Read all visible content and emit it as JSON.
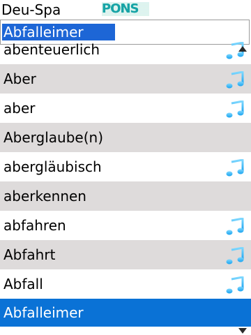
{
  "header": {
    "title": "Deu-Spa",
    "logo_text": "PONS"
  },
  "search": {
    "value": "Abfalleimer"
  },
  "list": {
    "items": [
      {
        "label": "abenteuerlich",
        "audio": true,
        "shaded": false,
        "selected": false
      },
      {
        "label": "Aber",
        "audio": true,
        "shaded": true,
        "selected": false
      },
      {
        "label": "aber",
        "audio": true,
        "shaded": false,
        "selected": false
      },
      {
        "label": "Aberglaube(n)",
        "audio": false,
        "shaded": true,
        "selected": false
      },
      {
        "label": "abergläubisch",
        "audio": true,
        "shaded": false,
        "selected": false
      },
      {
        "label": "aberkennen",
        "audio": false,
        "shaded": true,
        "selected": false
      },
      {
        "label": "abfahren",
        "audio": true,
        "shaded": false,
        "selected": false
      },
      {
        "label": "Abfahrt",
        "audio": true,
        "shaded": true,
        "selected": false
      },
      {
        "label": "Abfall",
        "audio": true,
        "shaded": false,
        "selected": false
      },
      {
        "label": "Abfalleimer",
        "audio": false,
        "shaded": false,
        "selected": true
      }
    ]
  },
  "colors": {
    "selection": "#0a72d6",
    "shade": "#dedbdb",
    "input_highlight": "#1d66d6",
    "note_icon": "#1aa3f0"
  },
  "icons": {
    "audio": "music-note-icon",
    "scroll_up": "scroll-up-arrow-icon",
    "scroll_down": "scroll-down-arrow-icon"
  }
}
